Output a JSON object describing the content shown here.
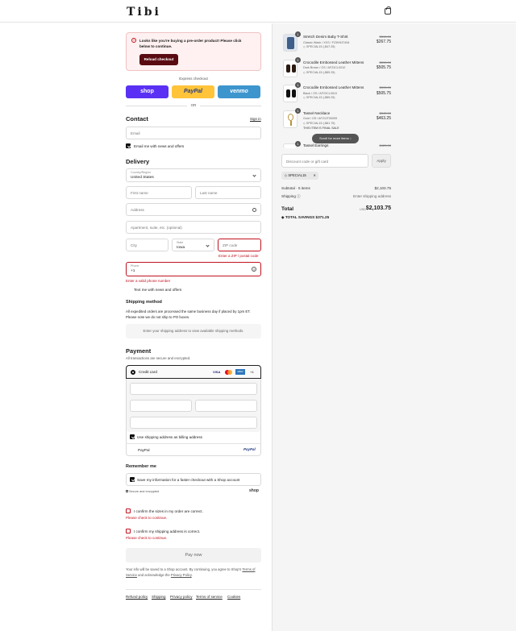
{
  "header": {
    "logo": "Tibi",
    "bag_icon": "shopping-bag-icon"
  },
  "alert": {
    "message": "Looks like you're buying a pre-order product! Please click below to continue.",
    "button": "Reload checkout"
  },
  "express": {
    "label": "Express checkout",
    "shop": "shop",
    "paypal": "PayPal",
    "venmo": "venmo",
    "or": "OR",
    "colors": {
      "shop": "#5a31f4",
      "paypal": "#ffc439",
      "venmo": "#3d95ce"
    }
  },
  "contact": {
    "title": "Contact",
    "sign_in": "Sign in",
    "email_placeholder": "Email",
    "newsletter": "Email me with news and offers"
  },
  "delivery": {
    "title": "Delivery",
    "country_label": "Country/Region",
    "country": "United States",
    "first_name": "First name",
    "last_name": "Last name",
    "address": "Address",
    "apartment": "Apartment, suite, etc. (optional)",
    "city": "City",
    "state_label": "State",
    "state": "Iowa",
    "zip": "ZIP code",
    "zip_error": "Enter a ZIP / postal code",
    "phone_label": "Phone",
    "phone_value": "+1",
    "phone_error": "Enter a valid phone number",
    "text_me": "Text me with news and offers"
  },
  "shipping": {
    "title": "Shipping method",
    "note": "All expedited orders are processed the same business day if placed by 1pm ET. Please note we do not ship to PO boxes.",
    "placeholder": "Enter your shipping address to view available shipping methods."
  },
  "payment": {
    "title": "Payment",
    "subtitle": "All transactions are secure and encrypted.",
    "credit_card": "Credit card",
    "cards": [
      "VISA",
      "MC",
      "AMEX",
      "+4"
    ],
    "billing_same": "Use shipping address as billing address",
    "paypal": "PayPal"
  },
  "remember": {
    "title": "Remember me",
    "save_info": "Save my information for a faster checkout with a Shop account",
    "secure": "Secure and encrypted",
    "shop": "shop"
  },
  "confirm": {
    "sizes": "I confirm the sizes in my order are correct.",
    "sizes_err": "Please check to continue.",
    "address": "I confirm my shipping address is correct.",
    "address_err": "Please check to continue."
  },
  "pay_now": "Pay now",
  "legal": {
    "line1": "Your info will be saved to a Shop account. By continuing, you agree to Shop's",
    "tos": "Terms of Service",
    "mid": "and acknowledge the",
    "privacy": "Privacy Policy"
  },
  "footer": [
    "Refund policy",
    "Shipping",
    "Privacy policy",
    "Terms of service",
    "Cookies"
  ],
  "cart": {
    "items": [
      {
        "qty": "1",
        "name": "Stretch Denim Baby T-Shirt",
        "variant": "Classic Wash / XXS / F23KN37454",
        "discount": "SPECIAL15 (-$47.25)",
        "orig": "$315.00",
        "price": "$267.75"
      },
      {
        "qty": "1",
        "name": "Crocodile Embossed Leather Mittens",
        "variant": "Dark Brown / OS / AF23CL0010",
        "discount": "SPECIAL15 (-$89.25)",
        "orig": "$595.00",
        "price": "$505.75"
      },
      {
        "qty": "1",
        "name": "Crocodile Embossed Leather Mittens",
        "variant": "Black / OS / AF23CL0010",
        "discount": "SPECIAL15 (-$89.25)",
        "orig": "$595.00",
        "price": "$505.75"
      },
      {
        "qty": "1",
        "name": "Tassel Necklace",
        "variant": "Gold / OS / AF23JT00099",
        "discount": "SPECIAL15 (-$81.75)",
        "final_sale": "THIS ITEM IS FINAL SALE",
        "orig": "$545.00",
        "price": "$463.25"
      },
      {
        "qty": "1",
        "name": "Tassel Earrings",
        "orig": "$425.00"
      }
    ],
    "scroll_hint": "Scroll for more items",
    "discount_placeholder": "Discount code or gift card",
    "apply": "Apply",
    "code_tag": "SPECIAL15",
    "subtotal_label": "Subtotal · 5 items",
    "subtotal": "$2,103.75",
    "shipping_label": "Shipping",
    "shipping_value": "Enter shipping address",
    "total_label": "Total",
    "currency": "USD",
    "total": "$2,103.75",
    "savings_label": "TOTAL SAVINGS",
    "savings": "$371.25"
  }
}
